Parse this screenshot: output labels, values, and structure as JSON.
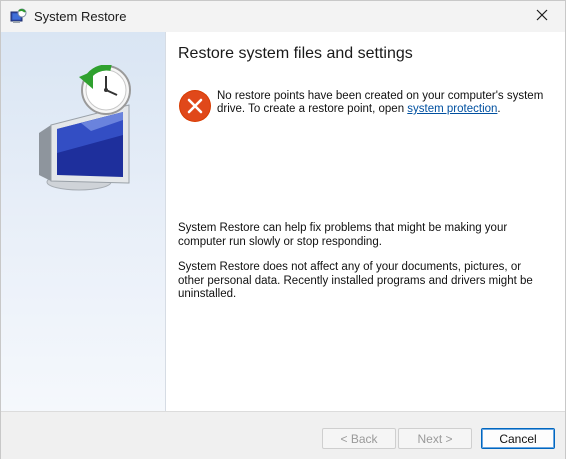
{
  "window": {
    "title": "System Restore",
    "icon": "system-restore-icon",
    "close_icon": "close-icon"
  },
  "sidebar": {
    "illustration": "monitor-with-restore-clock-icon"
  },
  "main": {
    "heading": "Restore system files and settings",
    "error": {
      "icon": "error-icon",
      "text_before": "No restore points have been created on your computer's system drive. To create a restore point, open ",
      "link_text": "system protection",
      "text_after": "."
    },
    "info_1": "System Restore can help fix problems that might be making your computer run slowly or stop responding.",
    "info_2": "System Restore does not affect any of your documents, pictures, or other personal data. Recently installed programs and drivers might be uninstalled."
  },
  "buttons": {
    "back": "< Back",
    "next": "Next >",
    "cancel": "Cancel"
  },
  "colors": {
    "accent": "#0067c0",
    "error": "#d83b01",
    "link": "#0050a0"
  }
}
